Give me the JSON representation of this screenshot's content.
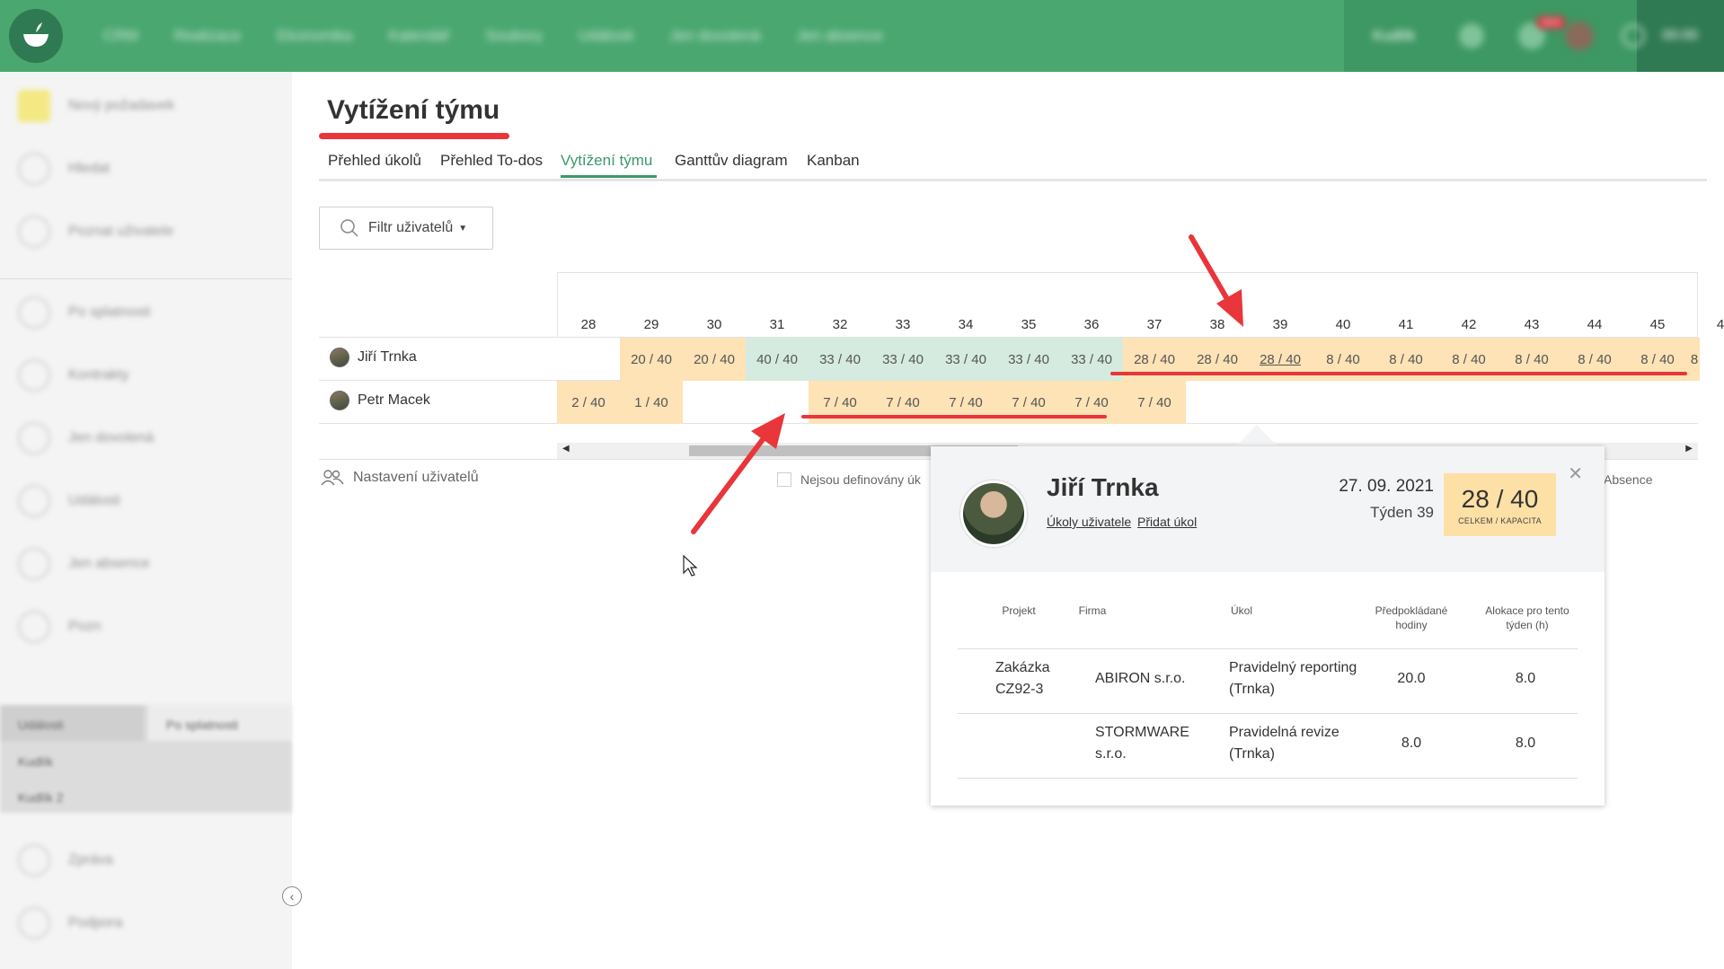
{
  "topbar": {
    "nav": [
      "CRM",
      "Realizace",
      "Ekonomika",
      "Kalendář",
      "Soubory",
      "Události",
      "Jen dovolená",
      "Jen absence"
    ],
    "company_selector": "Kudlík",
    "notification_badge": "NEW",
    "time": "00:00"
  },
  "sidebar": {
    "items": [
      "Nový požadavek",
      "Hledat",
      "Poznat uživatele",
      "Po splatnosti",
      "Kontrakty",
      "Jen dovolená",
      "Události",
      "Jen absence",
      "Pozn"
    ],
    "tabs": [
      "Události",
      "Po splatnosti"
    ],
    "list": [
      "Kudlík",
      "Kudlík 2"
    ],
    "footer": [
      "Zpráva",
      "Podpora"
    ]
  },
  "page": {
    "title": "Vytížení týmu",
    "tabs": [
      {
        "label": "Přehled úkolů",
        "active": false
      },
      {
        "label": "Přehled To-dos",
        "active": false
      },
      {
        "label": "Vytížení týmu",
        "active": true
      },
      {
        "label": "Ganttův diagram",
        "active": false
      },
      {
        "label": "Kanban",
        "active": false
      }
    ],
    "filter_label": "Filtr uživatelů",
    "settings_label": "Nastavení uživatelů",
    "checkbox_label": "Nejsou definovány úk",
    "absence_label": "Absence"
  },
  "grid": {
    "weeks": [
      "28",
      "29",
      "30",
      "31",
      "32",
      "33",
      "34",
      "35",
      "36",
      "37",
      "38",
      "39",
      "40",
      "41",
      "42",
      "43",
      "44",
      "45",
      "4"
    ],
    "users": [
      {
        "name": "Jiří Trnka",
        "cells": [
          "",
          "20 / 40",
          "20 / 40",
          "40 / 40",
          "33 / 40",
          "33 / 40",
          "33 / 40",
          "33 / 40",
          "33 / 40",
          "28 / 40",
          "28 / 40",
          "28 / 40",
          "8 / 40",
          "8 / 40",
          "8 / 40",
          "8 / 40",
          "8 / 40",
          "8 / 40",
          "8"
        ],
        "colors": [
          "none",
          "orange",
          "orange",
          "green",
          "green",
          "green",
          "green",
          "green",
          "green",
          "orange",
          "orange",
          "orange",
          "orange",
          "orange",
          "orange",
          "orange",
          "orange",
          "orange",
          "orange"
        ]
      },
      {
        "name": "Petr Macek",
        "cells": [
          "2 / 40",
          "1 / 40",
          "",
          "",
          "7 / 40",
          "7 / 40",
          "7 / 40",
          "7 / 40",
          "7 / 40",
          "7 / 40",
          "",
          "",
          "",
          "",
          "",
          "",
          "",
          "",
          ""
        ],
        "colors": [
          "orange",
          "orange",
          "none",
          "none",
          "orange",
          "orange",
          "orange",
          "orange",
          "orange",
          "orange",
          "none",
          "none",
          "none",
          "none",
          "none",
          "none",
          "none",
          "none",
          "none"
        ]
      }
    ],
    "highlighted_cell": {
      "user": 0,
      "week": "39"
    }
  },
  "popover": {
    "name": "Jiří Trnka",
    "link_tasks": "Úkoly uživatele",
    "link_add": "Přidat úkol",
    "date": "27. 09. 2021",
    "week": "Týden 39",
    "badge_value": "28 / 40",
    "badge_caption": "CELKEM / KAPACITA",
    "columns": [
      "Projekt",
      "Firma",
      "Úkol",
      "Předpokládané hodiny",
      "Alokace pro tento týden (h)"
    ],
    "rows": [
      {
        "project": "Zakázka CZ92-3",
        "company": "ABIRON s.r.o.",
        "task": "Pravidelný reporting (Trnka)",
        "hours": "20.0",
        "allocation": "8.0"
      },
      {
        "project": "",
        "company": "STORMWARE s.r.o.",
        "task": "Pravidelná revize (Trnka)",
        "hours": "8.0",
        "allocation": "8.0"
      }
    ]
  },
  "colors": {
    "brand_green": "#4aa770",
    "active_tab": "#3a9a68",
    "cell_orange": "#fde3b6",
    "cell_green": "#d5ebdf",
    "annotation_red": "#e8363a"
  }
}
